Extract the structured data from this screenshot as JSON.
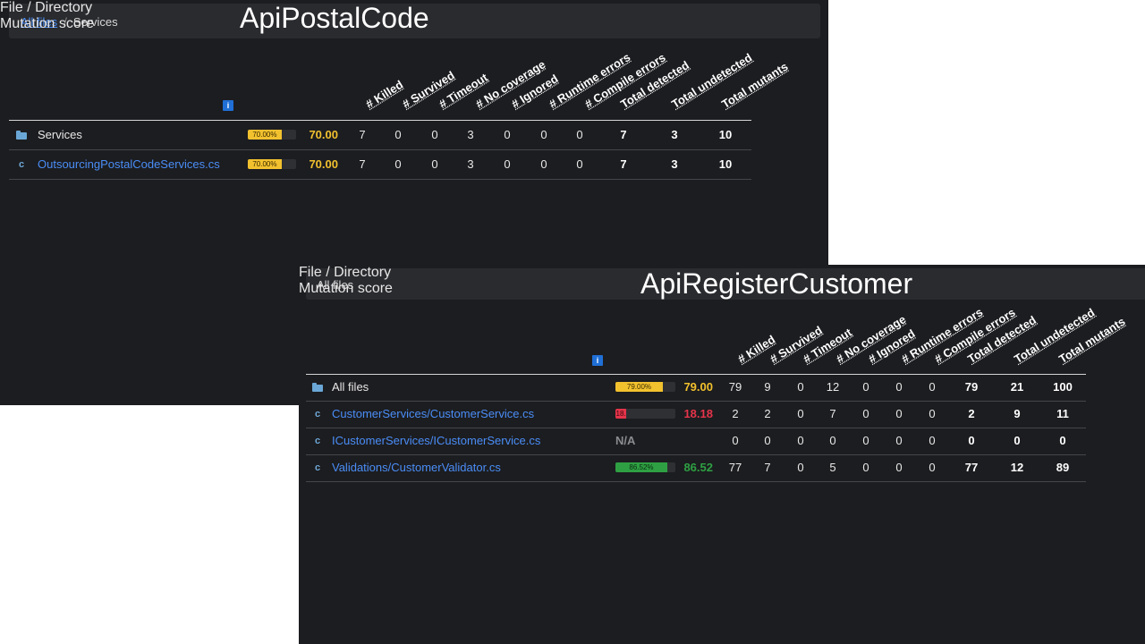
{
  "colors": {
    "warning": "#f2c12e",
    "danger": "#e5344a",
    "success": "#2ea043",
    "link": "#4a8df7"
  },
  "panel1": {
    "title": "ApiPostalCode",
    "breadcrumb": {
      "link": "All files",
      "separator": "/",
      "current": "Services"
    },
    "columns": {
      "file": "File / Directory",
      "info": "i",
      "score": "Mutation score",
      "metrics": [
        "# Killed",
        "# Survived",
        "# Timeout",
        "# No coverage",
        "# Ignored",
        "# Runtime errors",
        "# Compile errors",
        "Total detected",
        "Total undetected",
        "Total mutants"
      ]
    },
    "rows": [
      {
        "icon": "folder-icon",
        "name": "Services",
        "kind": "dir",
        "bar_label": "70.00%",
        "percent": 70.0,
        "score": "70.00",
        "status": "warning",
        "values": [
          "7",
          "0",
          "0",
          "3",
          "0",
          "0",
          "0",
          "7",
          "3",
          "10"
        ]
      },
      {
        "icon": "csharp-file-icon",
        "name": "OutsourcingPostalCodeServices.cs",
        "kind": "file",
        "bar_label": "70.00%",
        "percent": 70.0,
        "score": "70.00",
        "status": "warning",
        "values": [
          "7",
          "0",
          "0",
          "3",
          "0",
          "0",
          "0",
          "7",
          "3",
          "10"
        ]
      }
    ]
  },
  "panel2": {
    "title": "ApiRegisterCustomer",
    "breadcrumb": {
      "current": "All files"
    },
    "columns": {
      "file": "File / Directory",
      "info": "i",
      "score": "Mutation score",
      "metrics": [
        "# Killed",
        "# Survived",
        "# Timeout",
        "# No coverage",
        "# Ignored",
        "# Runtime errors",
        "# Compile errors",
        "Total detected",
        "Total undetected",
        "Total mutants"
      ]
    },
    "rows": [
      {
        "icon": "folder-icon",
        "name": "All files",
        "kind": "dir",
        "bar_label": "79.00%",
        "percent": 79.0,
        "score": "79.00",
        "status": "warning",
        "values": [
          "79",
          "9",
          "0",
          "12",
          "0",
          "0",
          "0",
          "79",
          "21",
          "100"
        ]
      },
      {
        "icon": "csharp-file-icon",
        "name": "CustomerServices/CustomerService.cs",
        "kind": "file",
        "bar_label": "18.",
        "percent": 18.18,
        "score": "18.18",
        "status": "danger",
        "values": [
          "2",
          "2",
          "0",
          "7",
          "0",
          "0",
          "0",
          "2",
          "9",
          "11"
        ]
      },
      {
        "icon": "csharp-file-icon",
        "name": "ICustomerServices/ICustomerService.cs",
        "kind": "file",
        "bar_label": "",
        "percent": null,
        "score": "N/A",
        "status": "na",
        "values": [
          "0",
          "0",
          "0",
          "0",
          "0",
          "0",
          "0",
          "0",
          "0",
          "0"
        ]
      },
      {
        "icon": "csharp-file-icon",
        "name": "Validations/CustomerValidator.cs",
        "kind": "file",
        "bar_label": "86.52%",
        "percent": 86.52,
        "score": "86.52",
        "status": "success",
        "values": [
          "77",
          "7",
          "0",
          "5",
          "0",
          "0",
          "0",
          "77",
          "12",
          "89"
        ]
      }
    ]
  }
}
